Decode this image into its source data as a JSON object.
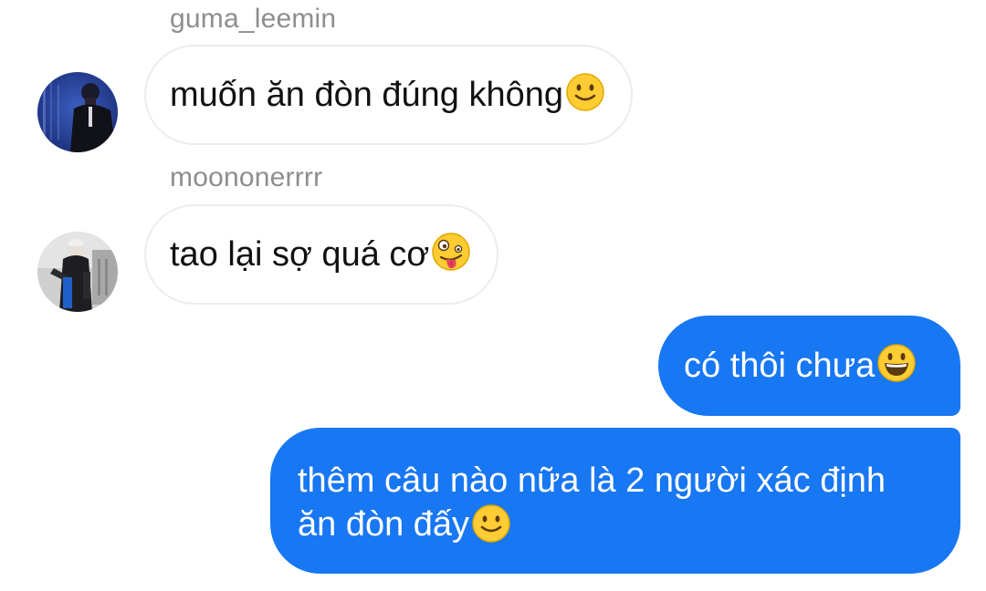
{
  "messages": [
    {
      "sender": "guma_leemin",
      "text": "muốn ăn đòn đúng không",
      "emoji": "slightly-smiling-face-icon",
      "direction": "incoming"
    },
    {
      "sender": "moononerrrr",
      "text": "tao lại sợ quá cơ",
      "emoji": "zany-face-icon",
      "direction": "incoming"
    },
    {
      "text": "có thôi chưa",
      "emoji": "grinning-face-icon",
      "direction": "outgoing"
    },
    {
      "lines": [
        "thêm câu nào nữa là 2 người xác định",
        "ăn đòn đấy"
      ],
      "emoji": "slightly-smiling-face-icon",
      "direction": "outgoing"
    }
  ],
  "colors": {
    "outgoing_bubble": "#1877f2",
    "incoming_bubble_border": "#ececec",
    "sender_name": "#8e8e8e",
    "emoji_face": "#ffcc33"
  }
}
